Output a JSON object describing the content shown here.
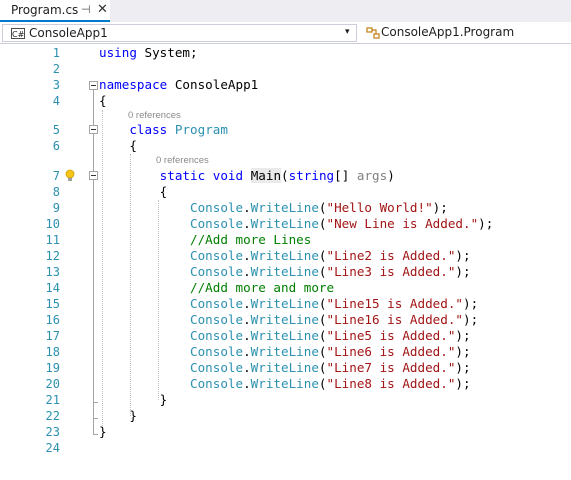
{
  "tab": {
    "title": "Program.cs",
    "pin_glyph": "⊣",
    "close_glyph": "✕"
  },
  "navbar": {
    "project_icon_text": "C#",
    "project": "ConsoleApp1",
    "member": "ConsoleApp1.Program",
    "caret": "▾"
  },
  "codelens": {
    "ref_class": "0 references",
    "ref_main": "0 references"
  },
  "lines": {
    "n": [
      "1",
      "2",
      "3",
      "4",
      "5",
      "6",
      "7",
      "8",
      "9",
      "10",
      "11",
      "12",
      "13",
      "14",
      "15",
      "16",
      "17",
      "18",
      "19",
      "20",
      "21",
      "22",
      "23",
      "24"
    ],
    "l1": {
      "kw": "using",
      "rest": " System;"
    },
    "l3": {
      "kw": "namespace",
      "rest": " ConsoleApp1"
    },
    "l4": "{",
    "l5": {
      "kw": "class",
      "name": "Program"
    },
    "l6": "{",
    "l7": {
      "kw1": "static",
      "kw2": "void",
      "method": "Main",
      "open": "(",
      "type": "string",
      "mid": "[] ",
      "param": "args",
      "close": ")"
    },
    "l8": "{",
    "console": "Console",
    "writeline": "WriteLine",
    "strings": {
      "l9": "\"Hello World!\"",
      "l10": "\"New Line is Added.\"",
      "l12": "\"Line2 is Added.\"",
      "l13": "\"Line3 is Added.\"",
      "l15": "\"Line15 is Added.\"",
      "l16": "\"Line16 is Added.\"",
      "l17": "\"Line5 is Added.\"",
      "l18": "\"Line6 is Added.\"",
      "l19": "\"Line7 is Added.\"",
      "l20": "\"Line8 is Added.\""
    },
    "c11": "//Add more Lines",
    "c14": "//Add more and more",
    "l21": "}",
    "l22": "}",
    "l23": "}"
  },
  "colors": {
    "keyword": "#0000ff",
    "type": "#2b91af",
    "string": "#a31515",
    "comment": "#008000",
    "accent": "#007acc"
  }
}
